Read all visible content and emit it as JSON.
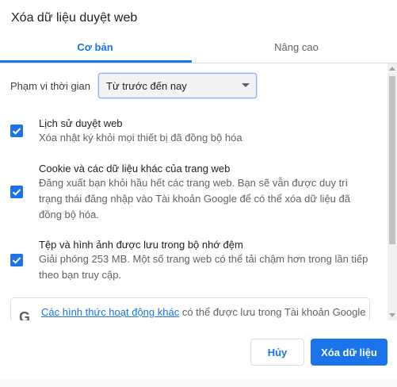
{
  "dialog": {
    "title": "Xóa dữ liệu duyệt web"
  },
  "tabs": [
    {
      "label": "Cơ bản",
      "selected": true
    },
    {
      "label": "Nâng cao",
      "selected": false
    }
  ],
  "time_range": {
    "label": "Phạm vi thời gian",
    "value": "Từ trước đến nay"
  },
  "items": [
    {
      "checked": true,
      "title": "Lịch sử duyệt web",
      "description": "Xóa nhật ký khỏi mọi thiết bị đã đồng bộ hóa"
    },
    {
      "checked": true,
      "title": "Cookie và các dữ liệu khác của trang web",
      "description": "Đăng xuất bạn khỏi hầu hết các trang web. Bạn sẽ vẫn được duy trì trạng thái đăng nhập vào Tài khoản Google để có thể xóa dữ liệu đã đồng bộ hóa."
    },
    {
      "checked": true,
      "title": "Tệp và hình ảnh được lưu trong bộ nhớ đệm",
      "description": "Giải phóng 253 MB. Một số trang web có thể tải chậm hơn trong lần tiếp theo bạn truy cập."
    }
  ],
  "account_notice": {
    "icon": "G",
    "link_text": "Các hình thức hoạt động khác",
    "text": " có thể được lưu trong Tài khoản Google"
  },
  "buttons": {
    "cancel": "Hủy",
    "confirm": "Xóa dữ liệu"
  },
  "colors": {
    "accent": "#1a73e8",
    "text_primary": "#202124",
    "text_secondary": "#5f6368"
  }
}
